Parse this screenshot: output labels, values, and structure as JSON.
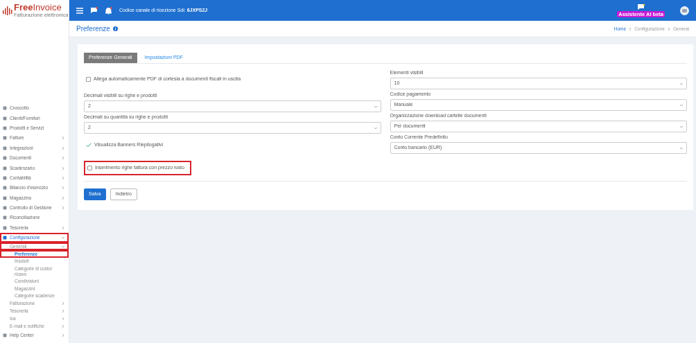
{
  "logo": {
    "name_bold": "Free",
    "name_light": "Invoice",
    "tagline": "Fatturazione elettronica"
  },
  "topbar": {
    "sdi_text": "Codice canale di ricezione Sdi: **6JXPS2J**",
    "assistant_label": "Assistente AI",
    "assistant_tag": "beta"
  },
  "page": {
    "title": "Preferenze",
    "breadcrumb": [
      "Home",
      "Configurazione",
      "General"
    ]
  },
  "sidebar": {
    "items": [
      {
        "label": "Cruscotto",
        "highlighted": false
      },
      {
        "label": "Clienti/Fornitori",
        "highlighted": false
      },
      {
        "label": "Prodotti e Servizi",
        "highlighted": false
      },
      {
        "label": "Fatture",
        "expanded": false,
        "highlighted": false
      },
      {
        "label": "Integrazioni",
        "expanded": false,
        "highlighted": false
      },
      {
        "label": "Documenti",
        "expanded": false,
        "highlighted": false
      },
      {
        "label": "Scadenzario",
        "expanded": false,
        "highlighted": false
      },
      {
        "label": "Contabilità",
        "expanded": false,
        "highlighted": false
      },
      {
        "label": "Bilancio d'esercizio",
        "expanded": false,
        "highlighted": false
      },
      {
        "label": "Magazzino",
        "expanded": false,
        "highlighted": false
      },
      {
        "label": "Controllo di Gestione",
        "expanded": false,
        "highlighted": false
      },
      {
        "label": "Riconciliazione",
        "highlighted": false
      },
      {
        "label": "Tesoreria",
        "expanded": false,
        "highlighted": false
      },
      {
        "label": "Configurazione",
        "expanded": true,
        "highlighted": true,
        "children": [
          {
            "label": "Generali",
            "expanded": true,
            "highlighted": true,
            "children": [
              {
                "label": "Preferenze",
                "selected": true,
                "highlighted": true
              },
              {
                "label": "Insoluti",
                "selected": false,
                "highlighted": false
              },
              {
                "label": "Categorie di costo/ ricavo",
                "selected": false,
                "highlighted": false
              },
              {
                "label": "Condivisioni",
                "selected": false,
                "highlighted": false
              },
              {
                "label": "Magazzini",
                "selected": false,
                "highlighted": false
              },
              {
                "label": "Categorie scadenze",
                "selected": false,
                "highlighted": false
              }
            ]
          },
          {
            "label": "Fatturazione",
            "expanded": false,
            "highlighted": false
          },
          {
            "label": "Tesoreria",
            "expanded": false,
            "highlighted": false
          },
          {
            "label": "Iva",
            "expanded": false,
            "highlighted": false
          },
          {
            "label": "E-mail e notifiche",
            "expanded": false,
            "highlighted": false
          }
        ]
      },
      {
        "label": "Help Center",
        "expanded": false,
        "highlighted": false
      }
    ]
  },
  "tabs": [
    {
      "label": "Preferenze Generali",
      "selected": true
    },
    {
      "label": "Impostazioni PDF",
      "selected": false
    }
  ],
  "form": {
    "left": [
      {
        "kind": "checkbox",
        "label": "Allega automaticamente PDF di cortesia a documenti fiscali in uscita",
        "checked": false,
        "highlighted": false
      },
      {
        "kind": "select",
        "label": "Decimali visibili su righe e prodotti",
        "value": "2"
      },
      {
        "kind": "select",
        "label": "Decimali su quantità su righe e prodotti",
        "value": "2"
      },
      {
        "kind": "checkbox",
        "label": "Visualizza Banners Riepilogativi",
        "checked": true,
        "highlighted": false
      },
      {
        "kind": "checkbox",
        "label": "Inserimento righe fattura con prezzo ivato",
        "checked": false,
        "highlighted": true
      }
    ],
    "right": [
      {
        "kind": "select",
        "label": "Elementi visibili",
        "value": "10"
      },
      {
        "kind": "select",
        "label": "Codice pagamento",
        "value": "Manuale"
      },
      {
        "kind": "select",
        "label": "Organizzazione download cartelle documenti",
        "value": "Per documenti"
      },
      {
        "kind": "select",
        "label": "Conto Corrente Predefinito",
        "value": "Conto bancario (EUR)"
      }
    ]
  },
  "buttons": [
    {
      "label": "Salva",
      "kind": "primary"
    },
    {
      "label": "Indietro",
      "kind": "secondary"
    }
  ]
}
